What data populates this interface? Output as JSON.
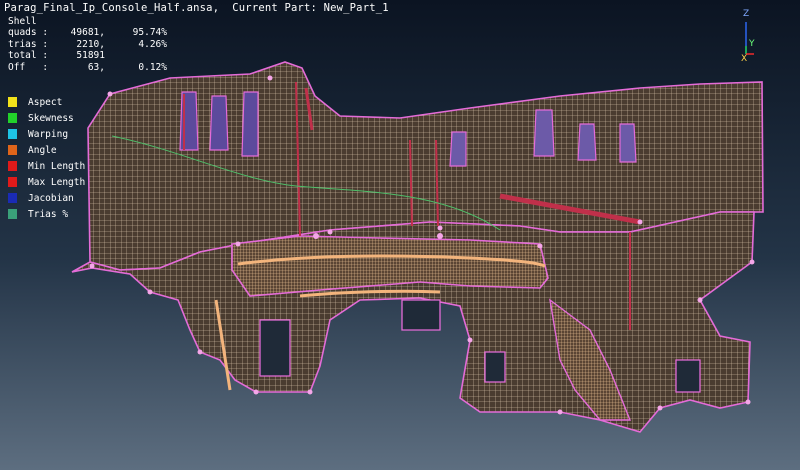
{
  "header": {
    "file_name": "Parag_Final_Ip_Console_Half.ansa,",
    "current_part_label": "Current Part: New_Part_1"
  },
  "stats": {
    "heading": "Shell",
    "rows": [
      {
        "label": "quads :",
        "count": "49681,",
        "percent": "95.74%"
      },
      {
        "label": "trias :",
        "count": "2210,",
        "percent": "4.26%"
      },
      {
        "label": "total :",
        "count": "51891",
        "percent": ""
      },
      {
        "label": "Off   :",
        "count": "63,",
        "percent": "0.12%"
      }
    ]
  },
  "quality_legend": [
    {
      "label": "Aspect",
      "color": "#f2e21a"
    },
    {
      "label": "Skewness",
      "color": "#22d12a"
    },
    {
      "label": "Warping",
      "color": "#1ec3e6"
    },
    {
      "label": "Angle",
      "color": "#e0651a"
    },
    {
      "label": "Min Length",
      "color": "#e01a1a"
    },
    {
      "label": "Max Length",
      "color": "#e01a1a"
    },
    {
      "label": "Jacobian",
      "color": "#1a2bb5"
    },
    {
      "label": "Trias %",
      "color": "#3aa07a"
    }
  ],
  "axes": {
    "z": "Z",
    "y": "Y",
    "x": "X"
  },
  "colors": {
    "mesh_fill": "#4a3c30",
    "mesh_line": "#e8d4b8",
    "edge": "#e46cd8",
    "accent_orange": "#f3b47c"
  }
}
